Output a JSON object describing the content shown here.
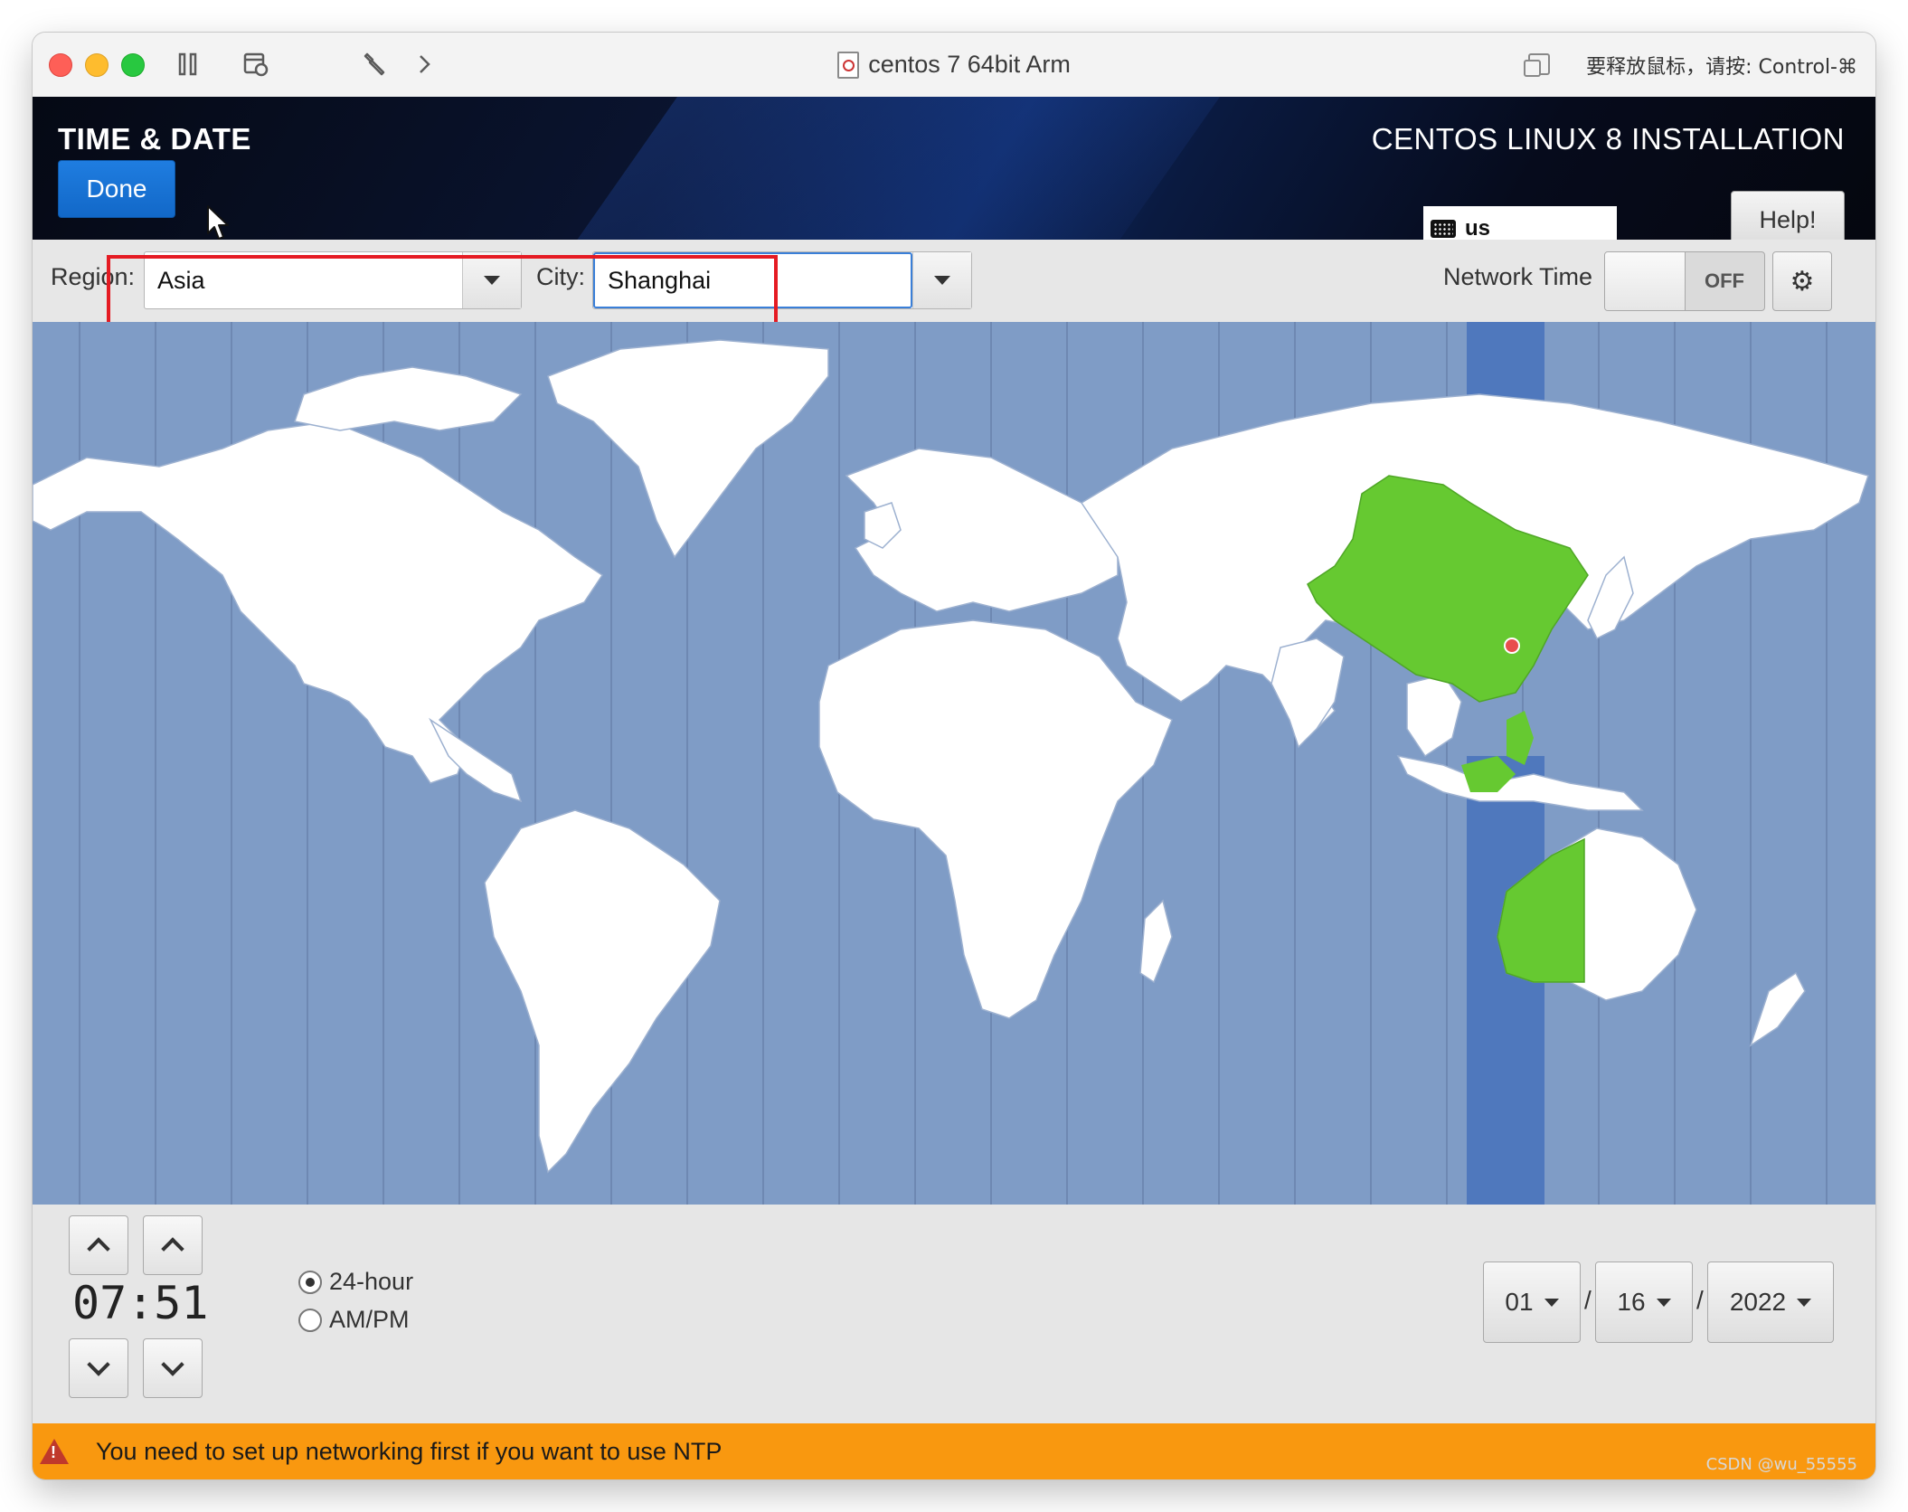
{
  "mac_window": {
    "title": "centos 7 64bit Arm",
    "release_hint": "要释放鼠标，请按: Control-⌘"
  },
  "header": {
    "title": "TIME & DATE",
    "done_label": "Done",
    "product_title": "CENTOS LINUX 8 INSTALLATION",
    "keyboard_layout": "us",
    "help_label": "Help!"
  },
  "region_bar": {
    "region_label": "Region:",
    "region_value": "Asia",
    "city_label": "City:",
    "city_value": "Shanghai",
    "network_time_label": "Network Time",
    "network_time_state": "OFF"
  },
  "map": {
    "selected_timezone_color": "#4f78bd",
    "highlight_country_color": "#66c931",
    "ocean_color": "#7f9cc6"
  },
  "time": {
    "value": "07:51",
    "format_options": [
      "24-hour",
      "AM/PM"
    ],
    "selected_format": "24-hour"
  },
  "date": {
    "month": "01",
    "day": "16",
    "year": "2022",
    "separator": "/"
  },
  "warning": {
    "text": "You need to set up networking first if you want to use NTP"
  },
  "watermark": "CSDN @wu_55555"
}
